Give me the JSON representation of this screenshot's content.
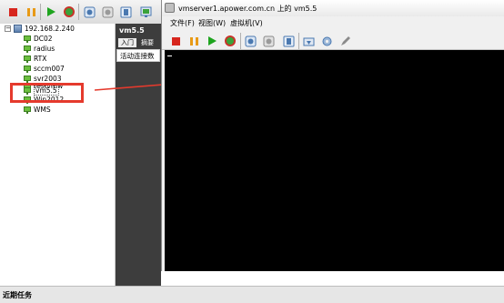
{
  "main": {
    "tree": {
      "host": "192.168.2.240",
      "items": [
        "DC02",
        "radius",
        "RTX",
        "sccm007",
        "svr2003",
        "testvmw",
        "vm5.5",
        "Win2012",
        "WMS"
      ]
    },
    "vm_panel": {
      "title": "vm5.5",
      "tabs": [
        "入门",
        "摘要"
      ],
      "subpanel": "活动连接数"
    },
    "bottom_bar": {
      "label": "近期任务"
    }
  },
  "console": {
    "title": "vmserver1.apower.com.cn 上的 vm5.5",
    "menu": [
      "文件(F)",
      "视图(W)",
      "虚拟机(V)"
    ]
  },
  "icons": [
    "stop-icon",
    "pause-icon",
    "play-icon",
    "refresh-icon",
    "snapshot-icon",
    "revert-icon",
    "manage-snapshot-icon",
    "console-icon",
    "send-keys-icon",
    "settings-icon",
    "edit-icon"
  ],
  "colors": {
    "highlight": "#e53a2d",
    "console_bg": "#000000",
    "vm_icon": "#6cbf3f"
  }
}
